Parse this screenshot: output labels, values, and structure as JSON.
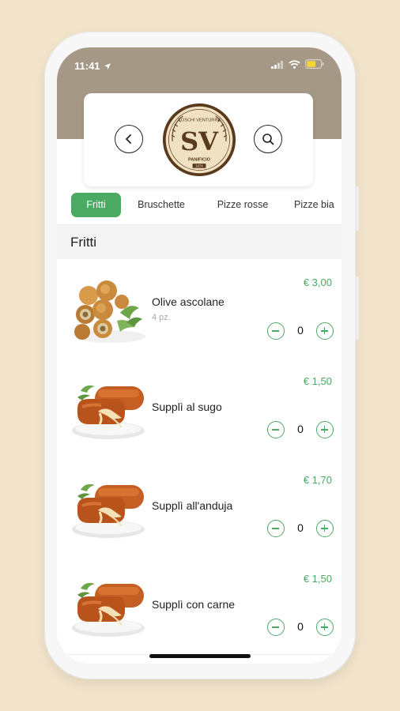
{
  "status_bar": {
    "time": "11:41"
  },
  "logo": {
    "brand": "SV",
    "top_text": "TOSCHI VENTURINI",
    "bottom_text": "PANIFICIO",
    "tag": "1974"
  },
  "tabs": [
    {
      "label": "Fritti",
      "active": true
    },
    {
      "label": "Bruschette",
      "active": false
    },
    {
      "label": "Pizze rosse",
      "active": false
    },
    {
      "label": "Pizze bia",
      "active": false
    }
  ],
  "section": {
    "title": "Fritti"
  },
  "items": [
    {
      "name": "Olive ascolane",
      "subtitle": "4 pz.",
      "price": "€ 3,00",
      "qty": "0",
      "image": "olive-ascolane-photo"
    },
    {
      "name": "Supplì al sugo",
      "subtitle": "",
      "price": "€ 1,50",
      "qty": "0",
      "image": "suppli-photo"
    },
    {
      "name": "Supplì all'anduja",
      "subtitle": "",
      "price": "€ 1,70",
      "qty": "0",
      "image": "suppli-photo"
    },
    {
      "name": "Supplì con carne",
      "subtitle": "",
      "price": "€ 1,50",
      "qty": "0",
      "image": "suppli-photo"
    }
  ],
  "colors": {
    "accent": "#4aaa62",
    "header_bg": "#a59886",
    "page_bg": "#f2e4cb",
    "logo_brown": "#5a3a1c",
    "logo_cream": "#efe1c2"
  },
  "icons": {
    "back": "chevron-left-icon",
    "search": "search-icon",
    "minus": "minus-icon",
    "plus": "plus-icon"
  }
}
